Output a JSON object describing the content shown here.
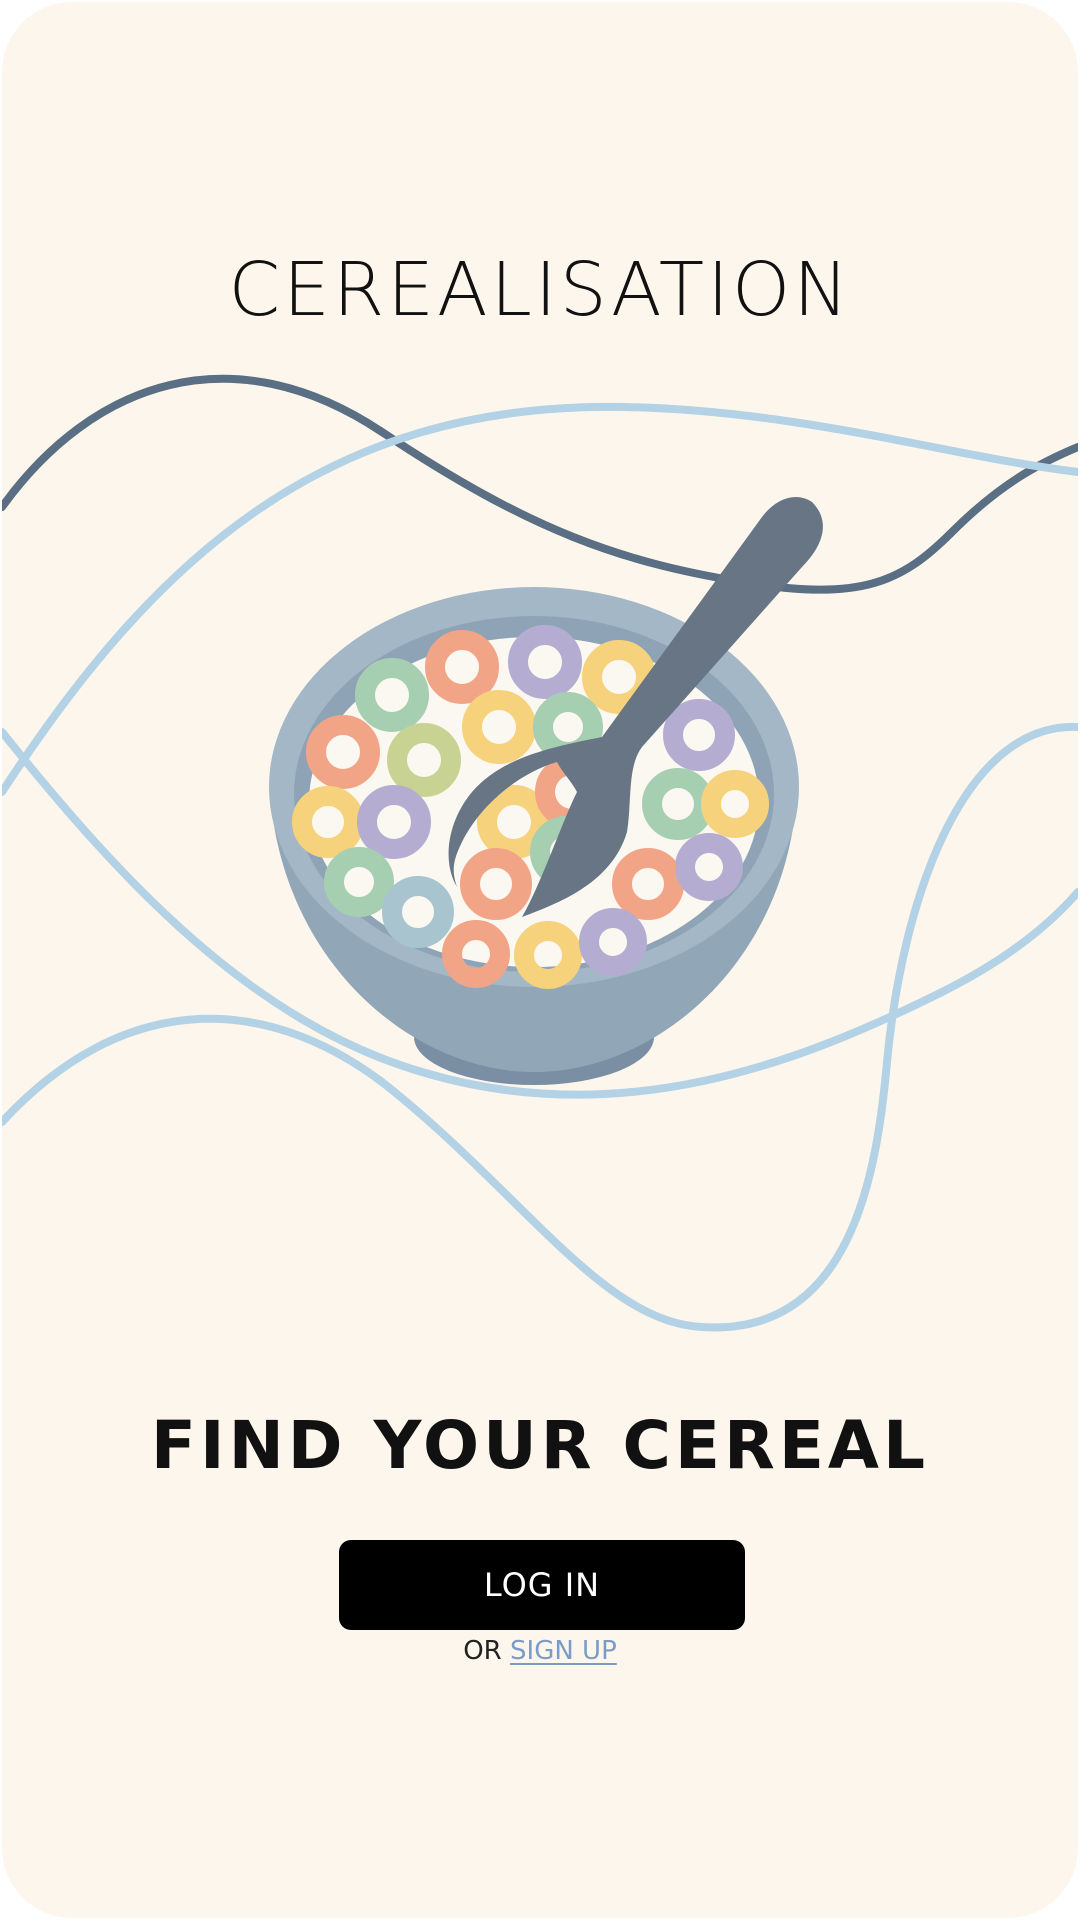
{
  "app": {
    "title": "CEREALISATION"
  },
  "hero": {
    "tagline": "FIND YOUR CEREAL",
    "illustration": "cereal-bowl-with-spoon",
    "cereal_colors": [
      "#f2a586",
      "#a6cfb1",
      "#b5add1",
      "#f7d27c",
      "#c8d393",
      "#a7c4cf"
    ]
  },
  "auth": {
    "login_label": "LOG IN",
    "or_label": "OR",
    "signup_label": "SIGN UP"
  },
  "colors": {
    "background": "#fdf6ec",
    "accent_dark_line": "#5a6e84",
    "accent_light_line": "#b4d2e6",
    "button": "#000000",
    "link": "#7b9cc9"
  }
}
